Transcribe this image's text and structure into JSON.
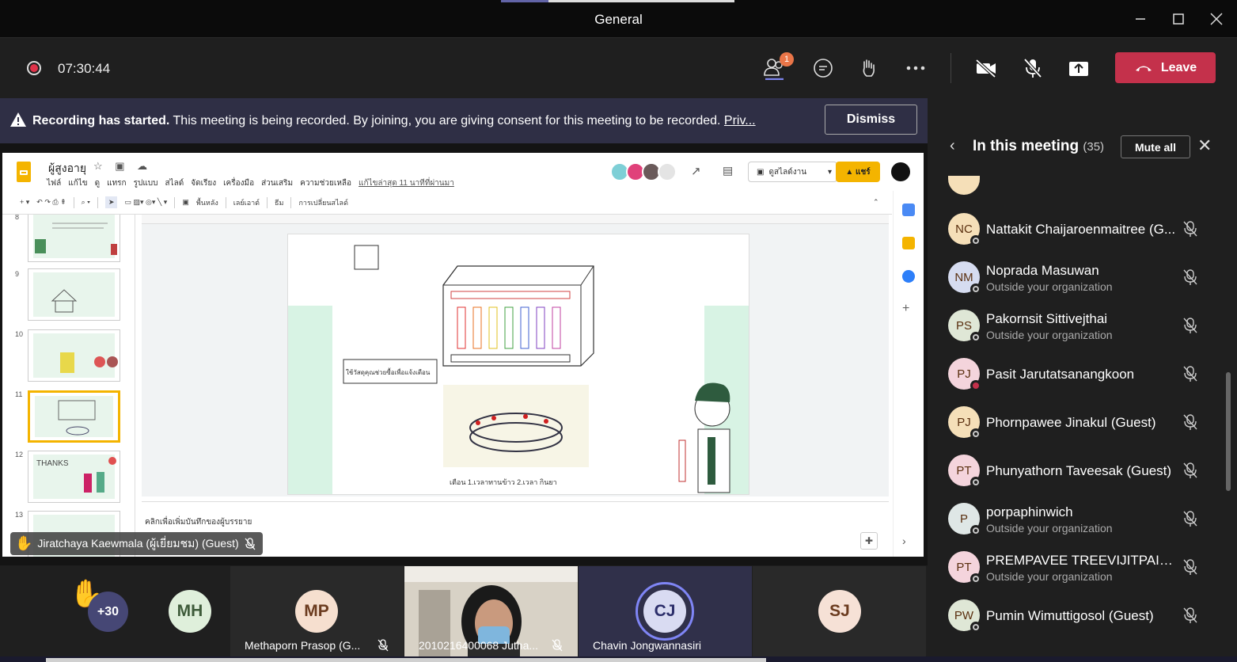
{
  "window": {
    "title": "General"
  },
  "toolbar": {
    "timer": "07:30:44",
    "participants_badge": "1",
    "leave_label": "Leave",
    "colors": {
      "leave": "#c4314b",
      "record": "#e0334a",
      "badge": "#e97548"
    }
  },
  "banner": {
    "bold": "Recording has started.",
    "text": " This meeting is being recorded. By joining, you are giving consent for this meeting to be recorded. ",
    "link": "Priv...",
    "dismiss_label": "Dismiss"
  },
  "shared": {
    "doc_title": "ผู้สูงอายุ",
    "menu": [
      "ไฟล์",
      "แก้ไข",
      "ดู",
      "แทรก",
      "รูปแบบ",
      "สไลด์",
      "จัดเรียง",
      "เครื่องมือ",
      "ส่วนเสริม",
      "ความช่วยเหลือ"
    ],
    "last_edit": "แก้ไขล่าสุด 11 นาทีที่ผ่านมา",
    "present_label": "ดูสไลด์งาน",
    "share_label": "แชร์",
    "tools": [
      "พื้นหลัง",
      "เลย์เอาต์",
      "ธีม",
      "การเปลี่ยนสไลด์"
    ],
    "thumb_numbers": [
      "8",
      "9",
      "10",
      "11",
      "12",
      "13"
    ],
    "thumb_12_text": "THANKS",
    "notes_placeholder": "คลิกเพื่อเพิ่มบันทึกของผู้บรรยาย",
    "slide_caption": "เตือน  1.เวลาทานข้าว  2.เวลา กินยา",
    "slide_box_label": "ใช้วัสดุคุณช่วยซื้อเพื่อแจ้งเตือน"
  },
  "raised_hand": {
    "name": "Jiratchaya Kaewmala (ผู้เยี่ยมชม) (Guest)"
  },
  "tiles": {
    "overflow": "+30",
    "mh": {
      "initials": "MH"
    },
    "mp": {
      "initials": "MP",
      "name": "Methaporn Prasop (G..."
    },
    "video": {
      "name": "2010216400068 Jutha..."
    },
    "cj": {
      "initials": "CJ",
      "name": "Chavin Jongwannasiri"
    },
    "sj": {
      "initials": "SJ"
    }
  },
  "panel": {
    "title": "In this meeting",
    "count": "(35)",
    "mute_all_label": "Mute all",
    "people": [
      {
        "initials": "NC",
        "name": "Nattakit Chaijaroenmaitree (G...",
        "sub": "",
        "color": "#f5dfb8"
      },
      {
        "initials": "NM",
        "name": "Noprada Masuwan",
        "sub": "Outside your organization",
        "color": "#d6dcf0"
      },
      {
        "initials": "PS",
        "name": "Pakornsit Sittivejthai",
        "sub": "Outside your organization",
        "color": "#dfe7d6"
      },
      {
        "initials": "PJ",
        "name": "Pasit Jarutatsanangkoon",
        "sub": "",
        "color": "#f4d4dc"
      },
      {
        "initials": "PJ",
        "name": "Phornpawee Jinakul (Guest)",
        "sub": "",
        "color": "#f5dfb8"
      },
      {
        "initials": "PT",
        "name": "Phunyathorn Taveesak (Guest)",
        "sub": "",
        "color": "#f4d4dc"
      },
      {
        "initials": "P",
        "name": "porpaphinwich",
        "sub": "Outside your organization",
        "color": "#dfe7e6"
      },
      {
        "initials": "PT",
        "name": "PREMPAVEE TREEVIJITPAISAN",
        "sub": "Outside your organization",
        "color": "#f4d4dc"
      },
      {
        "initials": "PW",
        "name": "Pumin Wimuttigosol (Guest)",
        "sub": "",
        "color": "#dfe7d6"
      }
    ]
  }
}
